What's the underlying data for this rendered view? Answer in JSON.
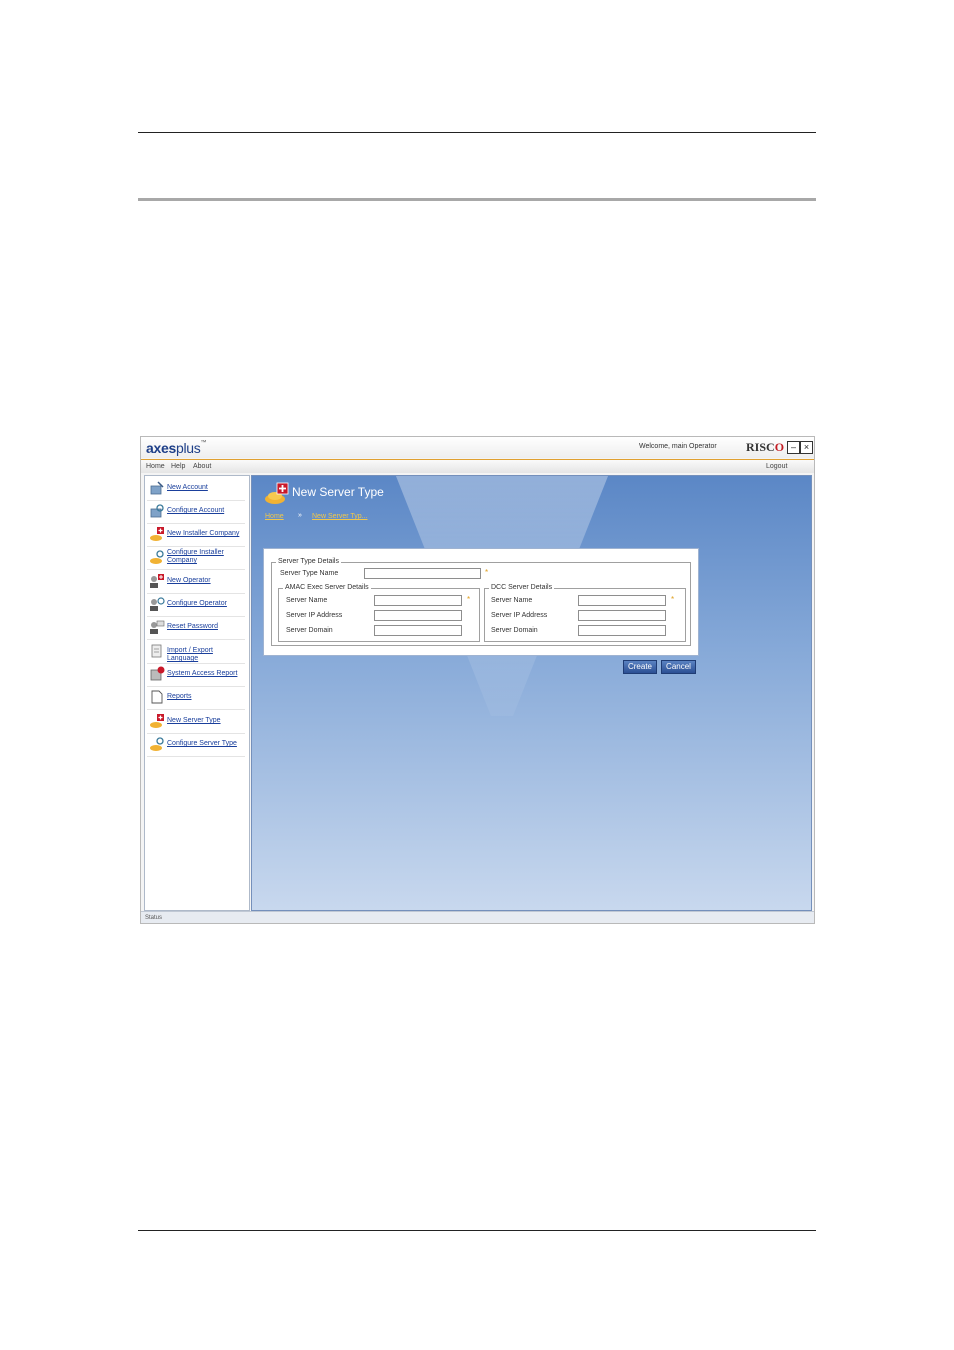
{
  "app": {
    "logo_main": "axes",
    "logo_sub": "plus",
    "logo_tm": "™",
    "welcome_text": "Welcome, main Operator",
    "brand": "RISC",
    "brand_mark": "O"
  },
  "window_controls": {
    "minimize": "–",
    "close": "×"
  },
  "menu": {
    "home": "Home",
    "help": "Help",
    "about": "About",
    "logout": "Logout"
  },
  "sidebar": {
    "items": [
      {
        "label": "New Account",
        "icon": "new-account-icon"
      },
      {
        "label": "Configure Account",
        "icon": "configure-account-icon"
      },
      {
        "label": "New Installer Company",
        "icon": "new-installer-company-icon"
      },
      {
        "label": "Configure Installer Company",
        "icon": "configure-installer-company-icon"
      },
      {
        "label": "New Operator",
        "icon": "new-operator-icon"
      },
      {
        "label": "Configure Operator",
        "icon": "configure-operator-icon"
      },
      {
        "label": "Reset Password",
        "icon": "reset-password-icon"
      },
      {
        "label": "Import / Export Language",
        "icon": "import-export-icon"
      },
      {
        "label": "System Access Report",
        "icon": "system-access-report-icon"
      },
      {
        "label": "Reports",
        "icon": "reports-icon"
      },
      {
        "label": "New Server Type",
        "icon": "new-server-type-icon"
      },
      {
        "label": "Configure Server Type",
        "icon": "configure-server-type-icon"
      }
    ]
  },
  "page": {
    "title": "New Server Type",
    "breadcrumb_home": "Home",
    "breadcrumb_sep": "»",
    "breadcrumb_current": "New Server Typ..."
  },
  "form": {
    "server_type_group": "Server Type Details",
    "server_type_name_label": "Server Type Name",
    "server_type_name_value": "",
    "required_mark": "*",
    "amac": {
      "group": "AMAC Exec Server Details",
      "server_name_label": "Server Name",
      "server_ip_label": "Server IP Address",
      "server_domain_label": "Server Domain",
      "server_name_value": "",
      "server_ip_value": "",
      "server_domain_value": ""
    },
    "dcc": {
      "group": "DCC Server Details",
      "server_name_label": "Server Name",
      "server_ip_label": "Server IP Address",
      "server_domain_label": "Server Domain",
      "server_name_value": "",
      "server_ip_value": "",
      "server_domain_value": ""
    },
    "create_label": "Create",
    "cancel_label": "Cancel"
  },
  "status": {
    "text": "Status"
  },
  "colors": {
    "accent": "#e0a030",
    "main_bg": "#5b87c6",
    "link": "#1a3f9c"
  }
}
